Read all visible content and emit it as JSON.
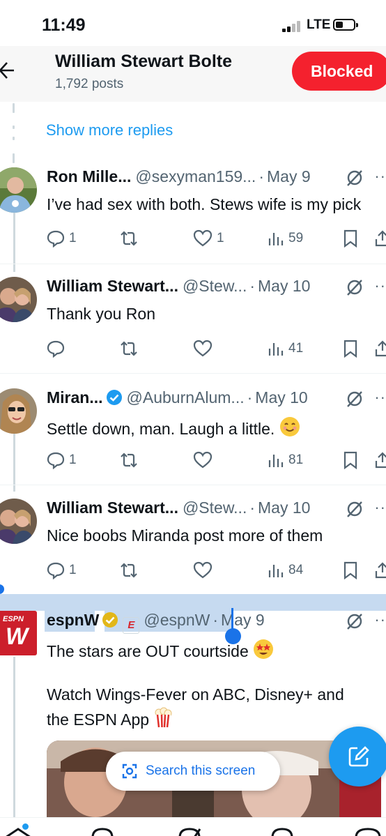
{
  "status_bar": {
    "time": "11:49",
    "network": "LTE"
  },
  "header": {
    "profile_name": "William Stewart Bolte",
    "post_count": "1,792 posts",
    "blocked_label": "Blocked",
    "blocked_color": "#f4212e"
  },
  "thread": {
    "show_more_label": "Show more replies",
    "link_color": "#1d9bf0",
    "replies": [
      {
        "name": "Ron Mille...",
        "handle": "@sexyman159...",
        "date": "May 9",
        "text": "I’ve had sex with both. Stews wife is my pick",
        "counts": {
          "replies": "1",
          "reposts": "",
          "likes": "1",
          "views": "59"
        }
      },
      {
        "name": "William Stewart...",
        "handle": "@Stew...",
        "date": "May 10",
        "text": "Thank you Ron",
        "counts": {
          "replies": "",
          "reposts": "",
          "likes": "",
          "views": "41"
        }
      },
      {
        "name": "Miran...",
        "handle": "@AuburnAlum...",
        "date": "May 10",
        "text": "Settle down, man. Laugh a little.",
        "counts": {
          "replies": "1",
          "reposts": "",
          "likes": "",
          "views": "81"
        }
      },
      {
        "name": "William Stewart...",
        "handle": "@Stew...",
        "date": "May 10",
        "text": "Nice boobs Miranda post more of them",
        "counts": {
          "replies": "1",
          "reposts": "",
          "likes": "",
          "views": "84"
        }
      }
    ]
  },
  "espn_post": {
    "name": "espnW",
    "handle": "@espnW",
    "date": "May 9",
    "badge_letter": "E",
    "text_line1": "The stars are OUT courtside",
    "text_line2": "Watch Wings-Fever on ABC, Disney+ and",
    "text_line3": "the ESPN App",
    "avatar_text_top": "ESPN",
    "avatar_text_main": "W"
  },
  "overlay": {
    "search_label": "Search this screen"
  },
  "icons": [
    "back-arrow-icon",
    "grok-icon",
    "more-icon",
    "reply-icon",
    "repost-icon",
    "like-icon",
    "views-icon",
    "bookmark-icon",
    "share-icon",
    "verified-icon",
    "lens-icon",
    "compose-icon",
    "home-icon",
    "search-icon"
  ]
}
